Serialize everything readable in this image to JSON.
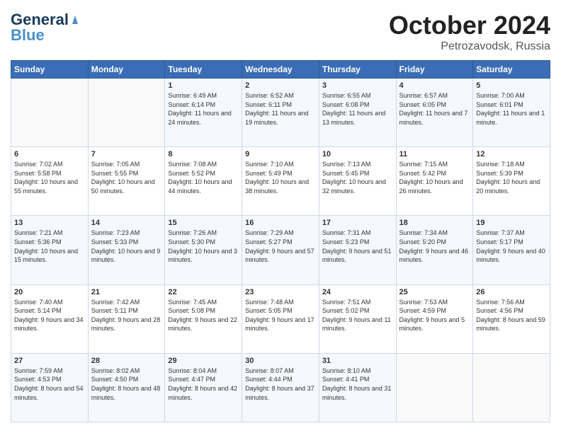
{
  "logo": {
    "part1": "General",
    "part2": "Blue"
  },
  "header": {
    "month": "October 2024",
    "location": "Petrozavodsk, Russia"
  },
  "days_of_week": [
    "Sunday",
    "Monday",
    "Tuesday",
    "Wednesday",
    "Thursday",
    "Friday",
    "Saturday"
  ],
  "weeks": [
    [
      {
        "day": "",
        "sunrise": "",
        "sunset": "",
        "daylight": ""
      },
      {
        "day": "",
        "sunrise": "",
        "sunset": "",
        "daylight": ""
      },
      {
        "day": "1",
        "sunrise": "Sunrise: 6:49 AM",
        "sunset": "Sunset: 6:14 PM",
        "daylight": "Daylight: 11 hours and 24 minutes."
      },
      {
        "day": "2",
        "sunrise": "Sunrise: 6:52 AM",
        "sunset": "Sunset: 6:11 PM",
        "daylight": "Daylight: 11 hours and 19 minutes."
      },
      {
        "day": "3",
        "sunrise": "Sunrise: 6:55 AM",
        "sunset": "Sunset: 6:08 PM",
        "daylight": "Daylight: 11 hours and 13 minutes."
      },
      {
        "day": "4",
        "sunrise": "Sunrise: 6:57 AM",
        "sunset": "Sunset: 6:05 PM",
        "daylight": "Daylight: 11 hours and 7 minutes."
      },
      {
        "day": "5",
        "sunrise": "Sunrise: 7:00 AM",
        "sunset": "Sunset: 6:01 PM",
        "daylight": "Daylight: 11 hours and 1 minute."
      }
    ],
    [
      {
        "day": "6",
        "sunrise": "Sunrise: 7:02 AM",
        "sunset": "Sunset: 5:58 PM",
        "daylight": "Daylight: 10 hours and 55 minutes."
      },
      {
        "day": "7",
        "sunrise": "Sunrise: 7:05 AM",
        "sunset": "Sunset: 5:55 PM",
        "daylight": "Daylight: 10 hours and 50 minutes."
      },
      {
        "day": "8",
        "sunrise": "Sunrise: 7:08 AM",
        "sunset": "Sunset: 5:52 PM",
        "daylight": "Daylight: 10 hours and 44 minutes."
      },
      {
        "day": "9",
        "sunrise": "Sunrise: 7:10 AM",
        "sunset": "Sunset: 5:49 PM",
        "daylight": "Daylight: 10 hours and 38 minutes."
      },
      {
        "day": "10",
        "sunrise": "Sunrise: 7:13 AM",
        "sunset": "Sunset: 5:45 PM",
        "daylight": "Daylight: 10 hours and 32 minutes."
      },
      {
        "day": "11",
        "sunrise": "Sunrise: 7:15 AM",
        "sunset": "Sunset: 5:42 PM",
        "daylight": "Daylight: 10 hours and 26 minutes."
      },
      {
        "day": "12",
        "sunrise": "Sunrise: 7:18 AM",
        "sunset": "Sunset: 5:39 PM",
        "daylight": "Daylight: 10 hours and 20 minutes."
      }
    ],
    [
      {
        "day": "13",
        "sunrise": "Sunrise: 7:21 AM",
        "sunset": "Sunset: 5:36 PM",
        "daylight": "Daylight: 10 hours and 15 minutes."
      },
      {
        "day": "14",
        "sunrise": "Sunrise: 7:23 AM",
        "sunset": "Sunset: 5:33 PM",
        "daylight": "Daylight: 10 hours and 9 minutes."
      },
      {
        "day": "15",
        "sunrise": "Sunrise: 7:26 AM",
        "sunset": "Sunset: 5:30 PM",
        "daylight": "Daylight: 10 hours and 3 minutes."
      },
      {
        "day": "16",
        "sunrise": "Sunrise: 7:29 AM",
        "sunset": "Sunset: 5:27 PM",
        "daylight": "Daylight: 9 hours and 57 minutes."
      },
      {
        "day": "17",
        "sunrise": "Sunrise: 7:31 AM",
        "sunset": "Sunset: 5:23 PM",
        "daylight": "Daylight: 9 hours and 51 minutes."
      },
      {
        "day": "18",
        "sunrise": "Sunrise: 7:34 AM",
        "sunset": "Sunset: 5:20 PM",
        "daylight": "Daylight: 9 hours and 46 minutes."
      },
      {
        "day": "19",
        "sunrise": "Sunrise: 7:37 AM",
        "sunset": "Sunset: 5:17 PM",
        "daylight": "Daylight: 9 hours and 40 minutes."
      }
    ],
    [
      {
        "day": "20",
        "sunrise": "Sunrise: 7:40 AM",
        "sunset": "Sunset: 5:14 PM",
        "daylight": "Daylight: 9 hours and 34 minutes."
      },
      {
        "day": "21",
        "sunrise": "Sunrise: 7:42 AM",
        "sunset": "Sunset: 5:11 PM",
        "daylight": "Daylight: 9 hours and 28 minutes."
      },
      {
        "day": "22",
        "sunrise": "Sunrise: 7:45 AM",
        "sunset": "Sunset: 5:08 PM",
        "daylight": "Daylight: 9 hours and 22 minutes."
      },
      {
        "day": "23",
        "sunrise": "Sunrise: 7:48 AM",
        "sunset": "Sunset: 5:05 PM",
        "daylight": "Daylight: 9 hours and 17 minutes."
      },
      {
        "day": "24",
        "sunrise": "Sunrise: 7:51 AM",
        "sunset": "Sunset: 5:02 PM",
        "daylight": "Daylight: 9 hours and 11 minutes."
      },
      {
        "day": "25",
        "sunrise": "Sunrise: 7:53 AM",
        "sunset": "Sunset: 4:59 PM",
        "daylight": "Daylight: 9 hours and 5 minutes."
      },
      {
        "day": "26",
        "sunrise": "Sunrise: 7:56 AM",
        "sunset": "Sunset: 4:56 PM",
        "daylight": "Daylight: 8 hours and 59 minutes."
      }
    ],
    [
      {
        "day": "27",
        "sunrise": "Sunrise: 7:59 AM",
        "sunset": "Sunset: 4:53 PM",
        "daylight": "Daylight: 8 hours and 54 minutes."
      },
      {
        "day": "28",
        "sunrise": "Sunrise: 8:02 AM",
        "sunset": "Sunset: 4:50 PM",
        "daylight": "Daylight: 8 hours and 48 minutes."
      },
      {
        "day": "29",
        "sunrise": "Sunrise: 8:04 AM",
        "sunset": "Sunset: 4:47 PM",
        "daylight": "Daylight: 8 hours and 42 minutes."
      },
      {
        "day": "30",
        "sunrise": "Sunrise: 8:07 AM",
        "sunset": "Sunset: 4:44 PM",
        "daylight": "Daylight: 8 hours and 37 minutes."
      },
      {
        "day": "31",
        "sunrise": "Sunrise: 8:10 AM",
        "sunset": "Sunset: 4:41 PM",
        "daylight": "Daylight: 8 hours and 31 minutes."
      },
      {
        "day": "",
        "sunrise": "",
        "sunset": "",
        "daylight": ""
      },
      {
        "day": "",
        "sunrise": "",
        "sunset": "",
        "daylight": ""
      }
    ]
  ]
}
